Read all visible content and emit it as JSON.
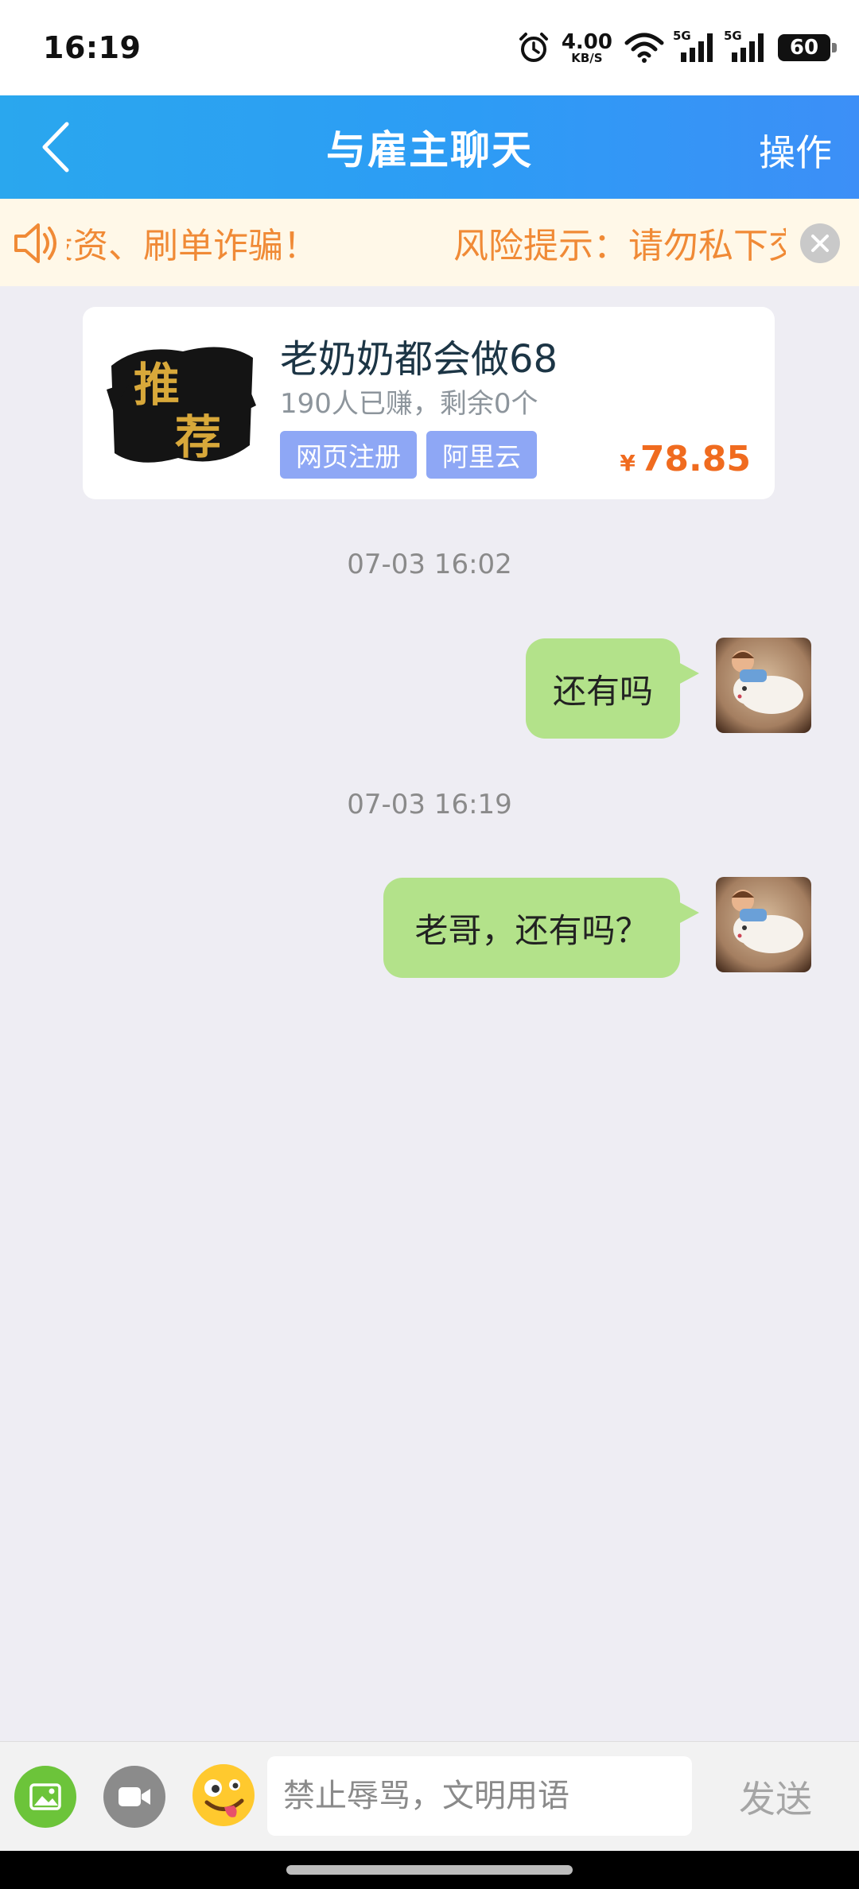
{
  "status_bar": {
    "time": "16:19",
    "net_speed_value": "4.00",
    "net_speed_unit": "KB/S",
    "sim1_label": "5G",
    "sim2_label": "5G",
    "battery": "60"
  },
  "header": {
    "title": "与雇主聊天",
    "action": "操作"
  },
  "notice": {
    "text_a": "投资、刷单诈骗！",
    "text_b": "风险提示：请勿私下交易"
  },
  "task": {
    "thumb_text": "推荐",
    "title": "老奶奶都会做68",
    "subtitle": "190人已赚，剩余0个",
    "tags": [
      "网页注册",
      "阿里云"
    ],
    "price_currency": "¥",
    "price": "78.85"
  },
  "messages": [
    {
      "timestamp": "07-03 16:02",
      "text": "还有吗",
      "sender": "self"
    },
    {
      "timestamp": "07-03 16:19",
      "text": "老哥，还有吗？",
      "sender": "self"
    }
  ],
  "input_bar": {
    "placeholder": "禁止辱骂，文明用语",
    "send_label": "发送"
  },
  "colors": {
    "header_blue": "#2d9cf5",
    "notice_orange": "#f08a36",
    "price_orange": "#f06b1f",
    "bubble_green": "#b3e28a",
    "tag_blue": "#8ea7f5"
  },
  "icons": [
    "back-arrow-icon",
    "speaker-icon",
    "close-icon",
    "image-icon",
    "video-icon",
    "emoji-icon",
    "alarm-icon",
    "wifi-icon",
    "signal-icon",
    "battery-icon"
  ]
}
